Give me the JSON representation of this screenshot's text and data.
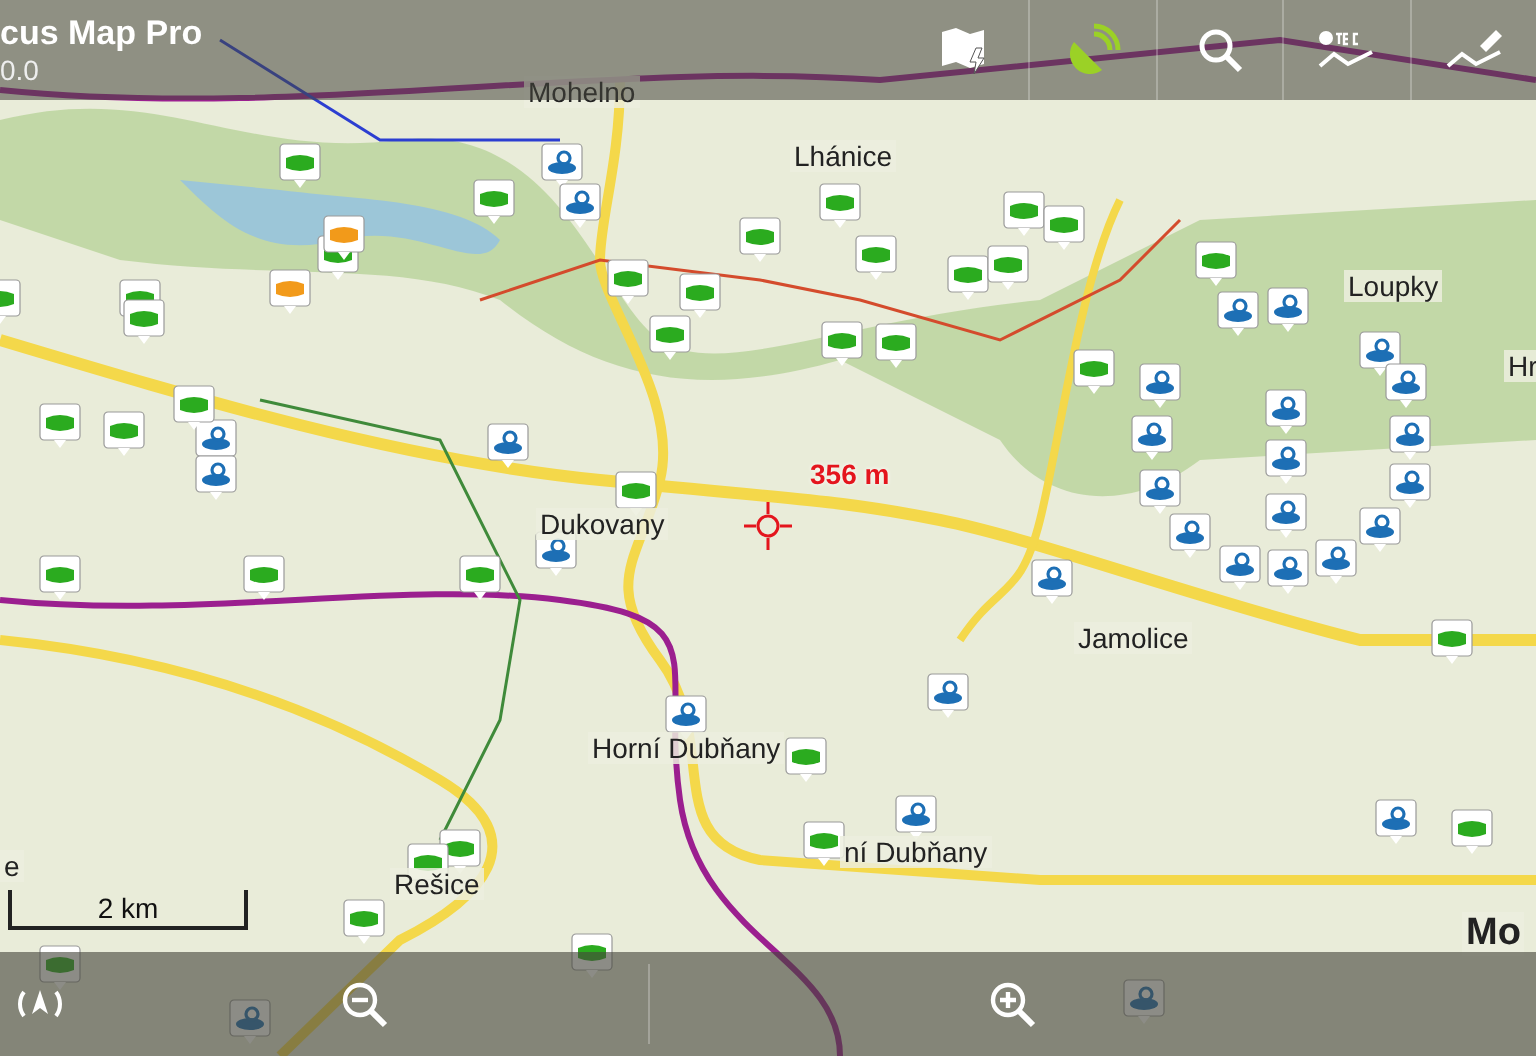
{
  "app_bar": {
    "title": "cus Map Pro",
    "subtitle": "0.0",
    "gps_fix": true
  },
  "map": {
    "labels": [
      {
        "kind": "town",
        "text": "Mohelno"
      },
      {
        "kind": "town",
        "text": "Lhánice"
      },
      {
        "kind": "town",
        "text": "Loupky"
      },
      {
        "kind": "town",
        "text": "Hr"
      },
      {
        "kind": "town",
        "text": "Dukovany"
      },
      {
        "kind": "town",
        "text": "Jamolice"
      },
      {
        "kind": "town",
        "text": "Horní Dubňany"
      },
      {
        "kind": "town",
        "text": "ní Dubňany"
      },
      {
        "kind": "town",
        "text": "Rešice"
      },
      {
        "kind": "town",
        "text": "e"
      },
      {
        "kind": "city",
        "text": "Mo"
      }
    ],
    "distance": "356 m",
    "scale": "2 km"
  }
}
